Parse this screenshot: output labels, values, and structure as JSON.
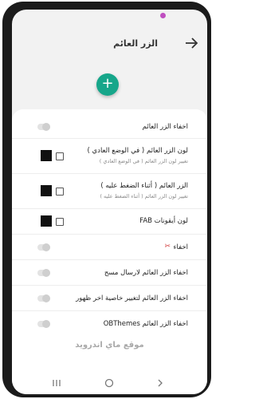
{
  "appbar": {
    "title": "الزر العائم"
  },
  "fab": {
    "symbol": "+"
  },
  "settings": [
    {
      "label": "اخفاء الزر العائم",
      "sub": "",
      "control": "toggle"
    },
    {
      "label": "لون الزر العائم ( في الوضع العادي )",
      "sub": "تغيير لون الزر العائم ( في الوضع العادي )",
      "control": "color",
      "color": "#111111"
    },
    {
      "label": "الزر العائم ( أثناء الضغط عليه )",
      "sub": "تغيير لون الزر العائم ( أثناء الضغط عليه )",
      "control": "color",
      "color": "#111111"
    },
    {
      "label": "لون أيقونات FAB",
      "sub": "",
      "control": "color",
      "color": "#111111"
    },
    {
      "label": "اخفاء",
      "sub": "",
      "control": "toggle",
      "icon": "scissors-icon"
    },
    {
      "label": "اخفاء الزر العائم لارسال مسج",
      "sub": "",
      "control": "toggle"
    },
    {
      "label": "اخفاء الزر العائم لتغيير خاصية اخر ظهور",
      "sub": "",
      "control": "toggle"
    },
    {
      "label": "اخفاء الزر العائم OBThemes",
      "sub": "",
      "control": "toggle"
    }
  ],
  "footer": {
    "text": "موقع ماي اندرويد"
  },
  "colors": {
    "accent": "#16a68a",
    "status_cam": "#bf4fc0"
  }
}
